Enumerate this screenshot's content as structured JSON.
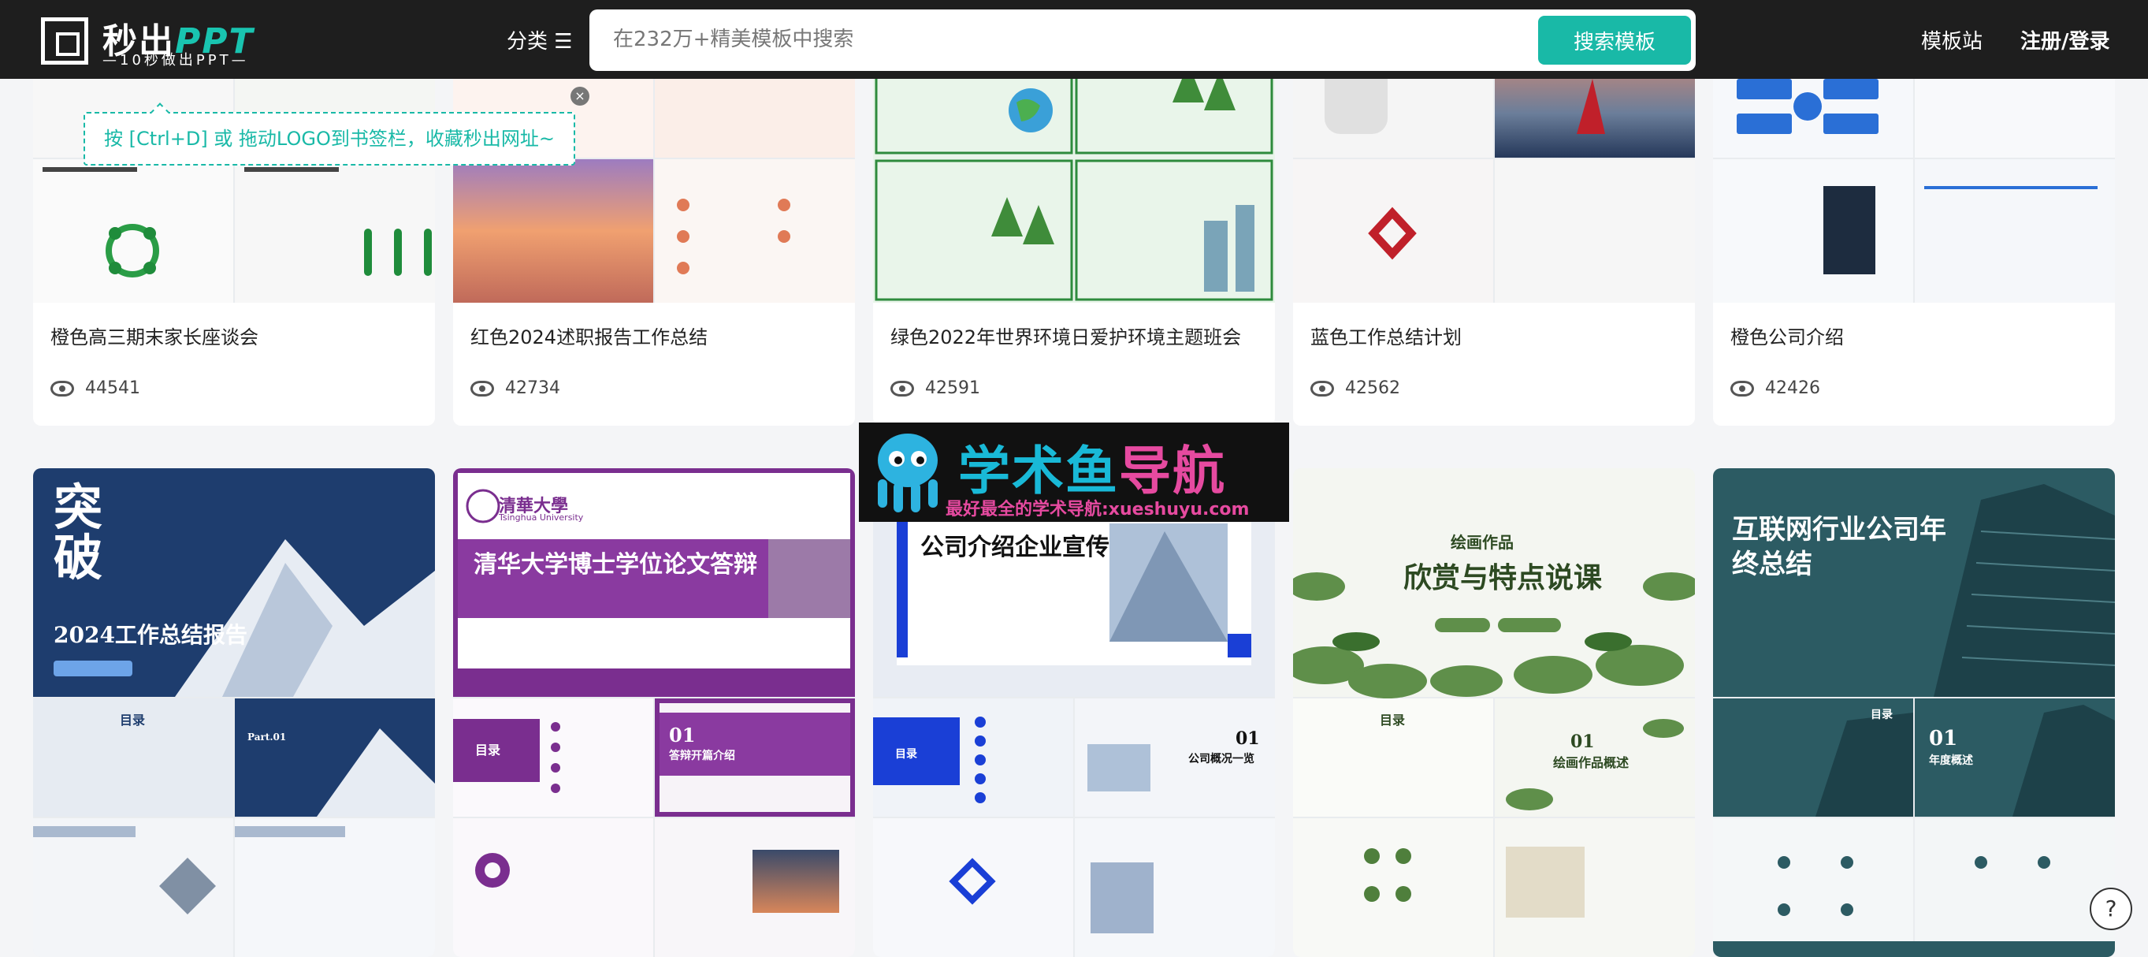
{
  "header": {
    "logo_title": "秒出",
    "logo_ppt": "PPT",
    "logo_sub": "—10秒做出PPT—",
    "category_label": "分类 ☰",
    "search_placeholder": "在232万+精美模板中搜索",
    "search_button": "搜索模板",
    "nav_template": "模板站",
    "nav_login": "注册/登录"
  },
  "tip": {
    "text": "按 [Ctrl+D] 或 拖动LOGO到书签栏，收藏秒出网址~",
    "close": "×"
  },
  "row1": [
    {
      "title": "橙色高三期末家长座谈会",
      "views": "44541"
    },
    {
      "title": "红色2024述职报告工作总结",
      "views": "42734"
    },
    {
      "title": "绿色2022年世界环境日爱护环境主题班会",
      "views": "42591"
    },
    {
      "title": "蓝色工作总结计划",
      "views": "42562"
    },
    {
      "title": "橙色公司介绍",
      "views": "42426"
    }
  ],
  "row2_thumbs": {
    "c1": {
      "title": "突破",
      "subtitle": "2024工作总结报告",
      "toc": "目录",
      "part": "Part.01"
    },
    "c2": {
      "uni": "清華大學",
      "uni_en": "Tsinghua University",
      "title": "清华大学博士学位论文答辩",
      "toc": "目录",
      "sec_num": "01",
      "sec": "答辩开篇介绍"
    },
    "c3": {
      "title": "公司介绍企业宣传",
      "toc": "目录",
      "sec_num": "01",
      "sec": "公司概况一览"
    },
    "c4": {
      "small": "绘画作品",
      "title": "欣赏与特点说课",
      "toc": "目录",
      "sec_num": "01",
      "sec": "绘画作品概述"
    },
    "c5": {
      "title": "互联网行业公司年终总结",
      "toc": "目录",
      "sec_num": "01",
      "sec": "年度概述"
    }
  },
  "watermark": {
    "title_a": "学术鱼",
    "title_b": "导航",
    "sub": "最好最全的学术导航:xueshuyu.com"
  },
  "help": "?"
}
